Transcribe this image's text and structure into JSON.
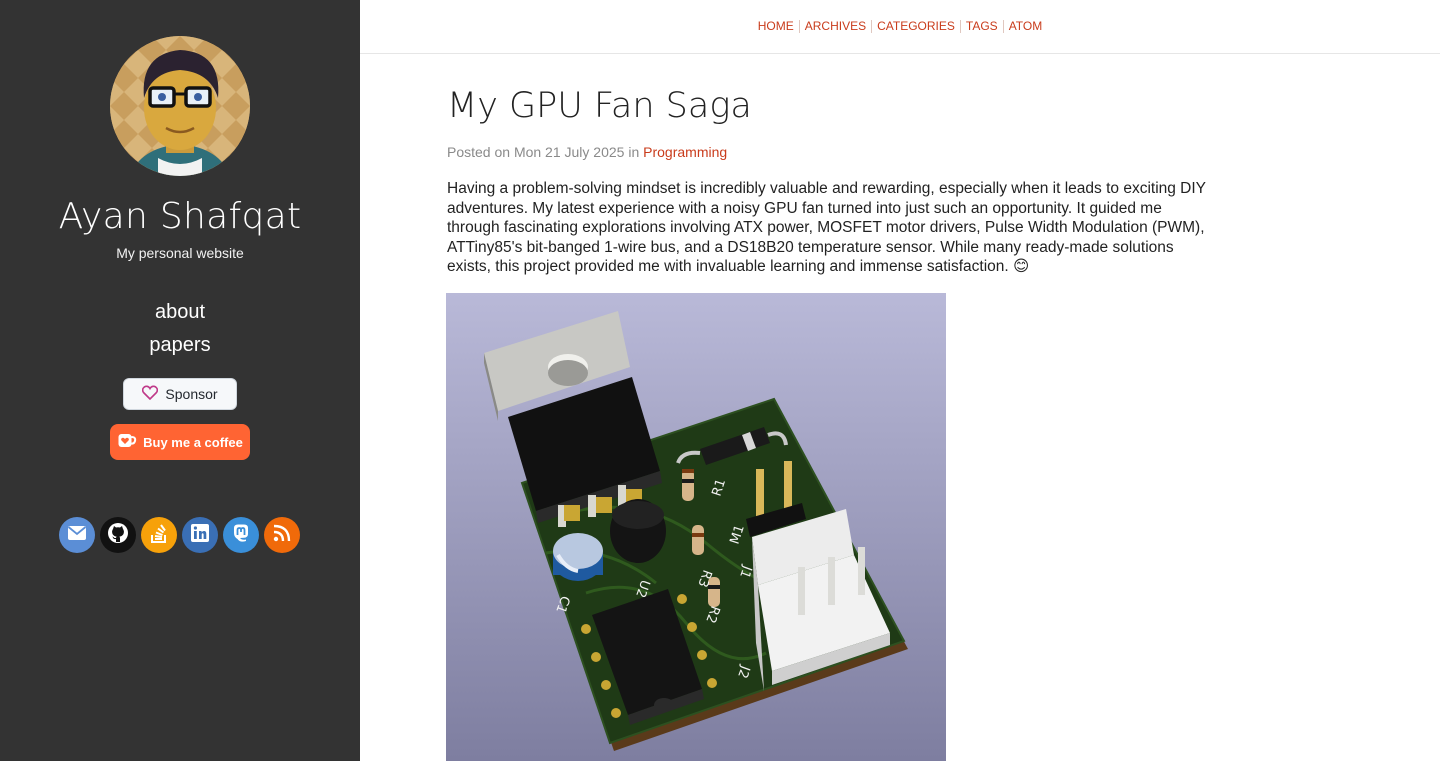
{
  "sidebar": {
    "title": "Ayan Shafqat",
    "subtitle": "My personal website",
    "nav": [
      {
        "label": "about"
      },
      {
        "label": "papers"
      }
    ],
    "sponsor_label": "Sponsor",
    "coffee_label": "Buy me a coffee",
    "socials": [
      {
        "icon": "email-icon",
        "color": "#5b8ed6"
      },
      {
        "icon": "github-icon",
        "color": "#111111"
      },
      {
        "icon": "stackoverflow-icon",
        "color": "#f7a10a"
      },
      {
        "icon": "linkedin-icon",
        "color": "#3a6fb5"
      },
      {
        "icon": "mastodon-icon",
        "color": "#3a8fd9"
      },
      {
        "icon": "rss-icon",
        "color": "#f06a0a"
      }
    ]
  },
  "topnav": [
    "HOME",
    "ARCHIVES",
    "CATEGORIES",
    "TAGS",
    "ATOM"
  ],
  "post": {
    "title": "My GPU Fan Saga",
    "meta_prefix": "Posted on Mon 21 July 2025 in ",
    "category": "Programming",
    "body": "Having a problem-solving mindset is incredibly valuable and rewarding, especially when it leads to exciting DIY adventures. My latest experience with a noisy GPU fan turned into just such an opportunity. It guided me through fascinating explorations involving ATX power, MOSFET motor drivers, Pulse Width Modulation (PWM), ATTiny85's bit-banged 1-wire bus, and a DS18B20 temperature sensor. While many ready-made solutions exists, this project provided me with invaluable learning and immense satisfaction. 😊",
    "figure_labels": [
      "R1",
      "M1",
      "U2",
      "C1",
      "R3",
      "R2",
      "J2",
      "J1"
    ]
  },
  "colors": {
    "accent": "#c93c1c",
    "sidebar_bg": "#333333",
    "coffee_btn": "#ff6433"
  }
}
